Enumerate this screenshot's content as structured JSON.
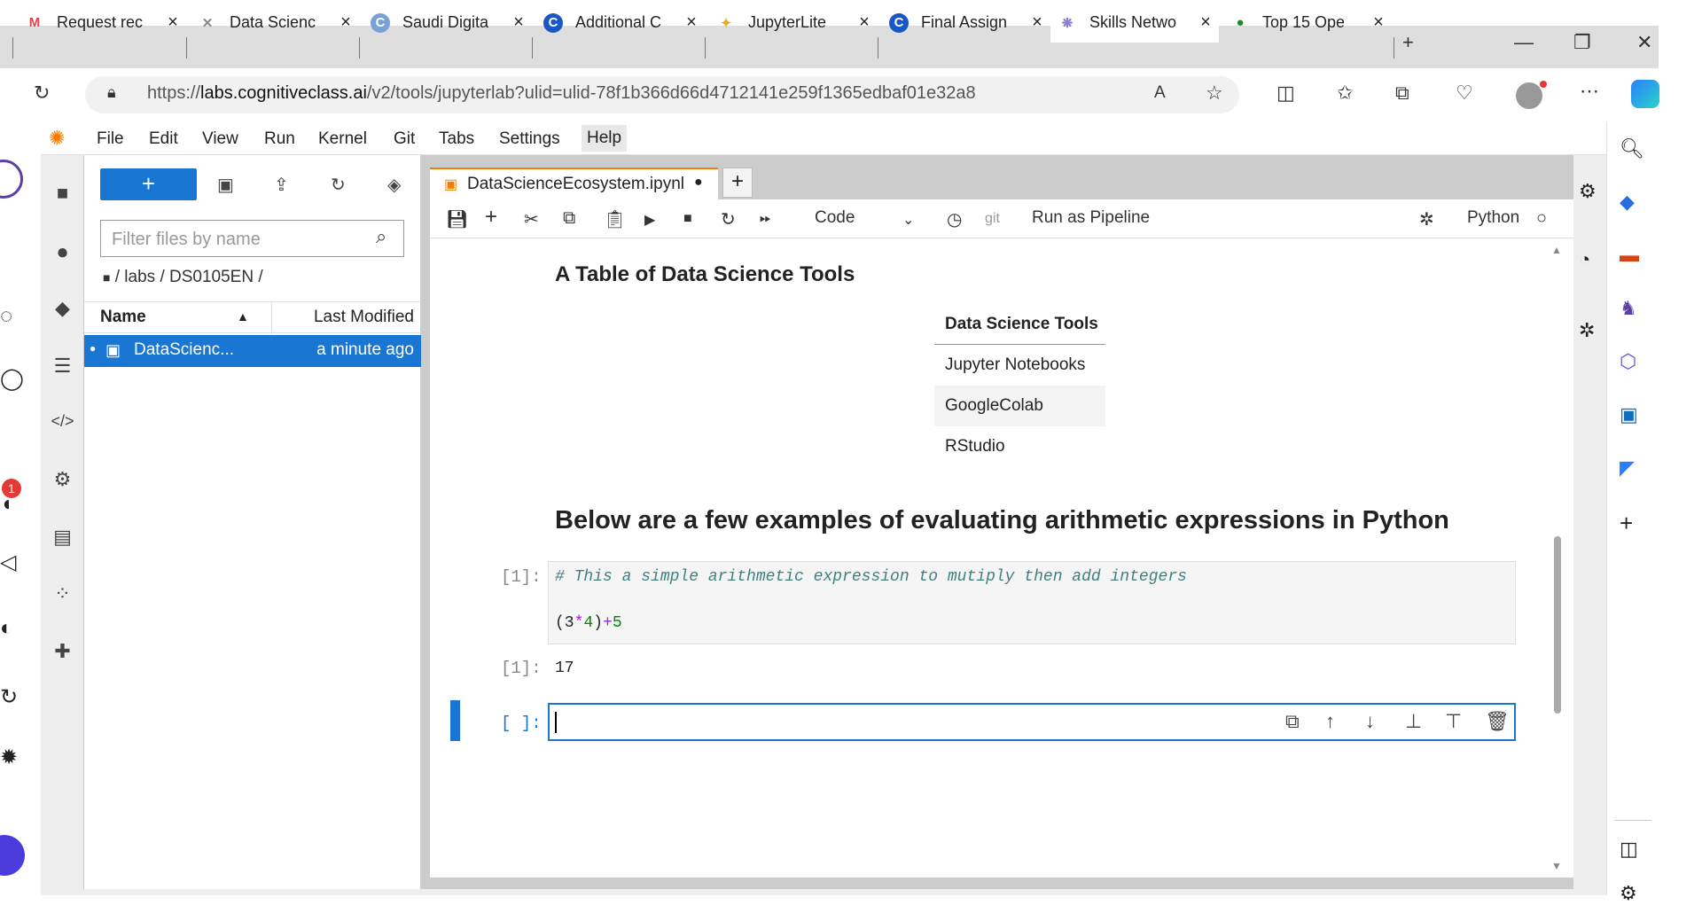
{
  "browser_tabs": [
    {
      "title": "Request rec",
      "icon": "gmail-icon"
    },
    {
      "title": "Data Scienc",
      "icon": "future-icon"
    },
    {
      "title": "Saudi Digita",
      "icon": "c-icon"
    },
    {
      "title": "Additional C",
      "icon": "c-icon"
    },
    {
      "title": "JupyterLite",
      "icon": "jupyterlite-icon"
    },
    {
      "title": "Final Assign",
      "icon": "c-icon"
    },
    {
      "title": "Skills Netwo",
      "icon": "skills-icon",
      "active": true
    },
    {
      "title": "Top 15 Ope",
      "icon": "green-icon"
    }
  ],
  "address": {
    "url_prefix": "https://",
    "url_domain": "labs.cognitiveclass.ai",
    "url_path": "/v2/tools/jupyterlab?ulid=ulid-78f1b366d66d4712141e259f1365edbaf01e32a8"
  },
  "menu": [
    "File",
    "Edit",
    "View",
    "Run",
    "Kernel",
    "Git",
    "Tabs",
    "Settings",
    "Help"
  ],
  "filebrowser": {
    "new_label": "+",
    "filter_placeholder": "Filter files by name",
    "breadcrumb": "/ labs / DS0105EN /",
    "col_name": "Name",
    "col_modified": "Last Modified",
    "file_name": "DataScienc...",
    "file_modified": "a minute ago"
  },
  "notebook": {
    "tab_title": "DataScienceEcosystem.ipynl",
    "cell_type": "Code",
    "git_label": "git",
    "pipeline_label": "Run as Pipeline",
    "kernel": "Python",
    "heading1": "A Table of Data Science Tools",
    "table_header": "Data Science Tools",
    "table_rows": [
      "Jupyter Notebooks",
      "GoogleColab",
      "RStudio"
    ],
    "heading2": "Below are a few examples of evaluating arithmetic expressions in Python",
    "cell1_prompt": "[1]:",
    "cell1_comment": "# This a simple arithmetic expression to mutiply then add integers",
    "cell1_code_a": "(3",
    "cell1_code_op1": "*",
    "cell1_code_b": "4",
    "cell1_code_c": ")",
    "cell1_code_op2": "+",
    "cell1_code_d": "5",
    "out1_prompt": "[1]:",
    "out1_value": "17",
    "cell2_prompt": "[ ]:"
  },
  "badge_count": "1",
  "colors": {
    "accent": "#1976d2",
    "orange": "#f57c00"
  }
}
